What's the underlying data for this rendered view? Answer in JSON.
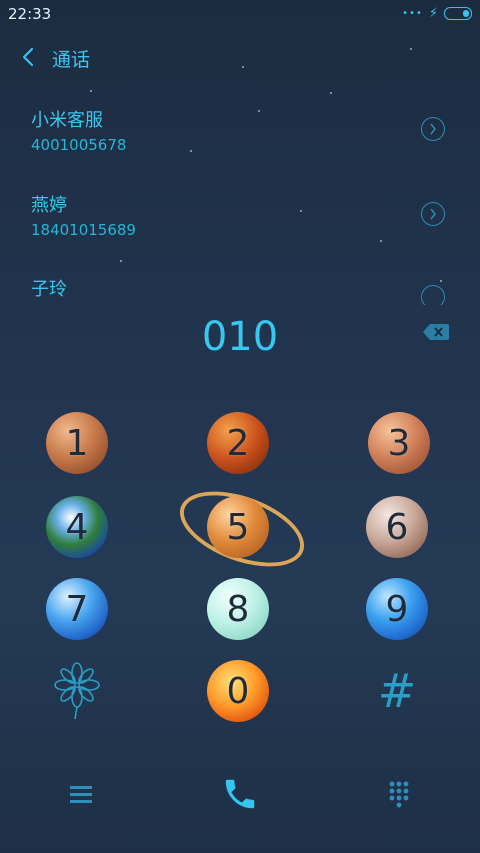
{
  "status": {
    "time": "22:33"
  },
  "header": {
    "title": "通话"
  },
  "contacts": [
    {
      "name": "小米客服",
      "number": "4001005678"
    },
    {
      "name": "燕婷",
      "number": "18401015689"
    },
    {
      "name": "子玲",
      "number": ""
    }
  ],
  "dial": {
    "number": "010"
  },
  "keys": [
    "1",
    "2",
    "3",
    "4",
    "5",
    "6",
    "7",
    "8",
    "9",
    "0"
  ],
  "symbols": {
    "star": "*",
    "hash": "#"
  },
  "colors": {
    "accent": "#33c5ef",
    "background": "#223550"
  }
}
